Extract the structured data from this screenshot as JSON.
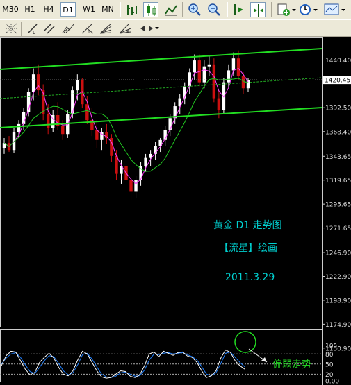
{
  "toolbar": {
    "timeframes": [
      "M30",
      "H1",
      "H4",
      "D1",
      "W1",
      "MN"
    ],
    "active_timeframe": "D1"
  },
  "annotations": {
    "line1": "黄金 D1 走势图",
    "line2": "【流星】绘画",
    "line3": "2011.3.29",
    "osc_note": "偏弱走势"
  },
  "chart_data": {
    "type": "candlestick",
    "symbol": "黄金",
    "timeframe": "D1",
    "price_axis": {
      "ticks": [
        "1440.40",
        "1392.50",
        "1368.40",
        "1343.65",
        "1319.65",
        "1295.65",
        "1271.65",
        "1246.90",
        "1222.90",
        "1198.90",
        "1174.90",
        "1150.90"
      ],
      "current_price": "1420.45",
      "ylim": [
        1150.9,
        1462
      ]
    },
    "oscillator": {
      "name": "Stochastic",
      "ticks": [
        "105",
        "80",
        "50",
        "20",
        "0.00"
      ],
      "levels": [
        80,
        50,
        20
      ],
      "k": [
        45,
        75,
        88,
        86,
        60,
        35,
        18,
        25,
        55,
        70,
        82,
        68,
        40,
        20,
        15,
        30,
        62,
        88,
        80,
        55,
        30,
        12,
        8,
        10,
        20,
        30,
        28,
        14,
        10,
        18,
        45,
        80,
        86,
        72,
        88,
        82,
        76,
        84,
        86,
        74,
        70,
        55,
        30,
        10,
        15,
        30,
        68,
        92,
        85,
        60,
        45,
        35
      ],
      "d": [
        50,
        68,
        80,
        84,
        70,
        48,
        28,
        22,
        40,
        60,
        75,
        72,
        52,
        30,
        18,
        24,
        48,
        78,
        82,
        65,
        42,
        20,
        12,
        10,
        14,
        24,
        26,
        20,
        14,
        15,
        32,
        62,
        80,
        78,
        82,
        84,
        80,
        82,
        84,
        78,
        72,
        62,
        42,
        20,
        16,
        24,
        52,
        82,
        86,
        70,
        55,
        42
      ]
    },
    "candles": [
      [
        1352,
        1362,
        1346,
        1357
      ],
      [
        1357,
        1364,
        1348,
        1350
      ],
      [
        1350,
        1372,
        1347,
        1368
      ],
      [
        1368,
        1380,
        1362,
        1376
      ],
      [
        1376,
        1392,
        1370,
        1388
      ],
      [
        1388,
        1412,
        1384,
        1408
      ],
      [
        1408,
        1432,
        1400,
        1426
      ],
      [
        1426,
        1436,
        1405,
        1410
      ],
      [
        1410,
        1416,
        1380,
        1386
      ],
      [
        1386,
        1396,
        1366,
        1372
      ],
      [
        1372,
        1390,
        1368,
        1385
      ],
      [
        1385,
        1398,
        1370,
        1374
      ],
      [
        1374,
        1380,
        1360,
        1366
      ],
      [
        1366,
        1390,
        1362,
        1386
      ],
      [
        1386,
        1414,
        1382,
        1410
      ],
      [
        1410,
        1426,
        1400,
        1420
      ],
      [
        1420,
        1422,
        1392,
        1396
      ],
      [
        1396,
        1404,
        1376,
        1380
      ],
      [
        1380,
        1392,
        1364,
        1370
      ],
      [
        1370,
        1380,
        1352,
        1360
      ],
      [
        1360,
        1372,
        1350,
        1368
      ],
      [
        1368,
        1376,
        1356,
        1362
      ],
      [
        1362,
        1366,
        1338,
        1344
      ],
      [
        1344,
        1350,
        1320,
        1326
      ],
      [
        1326,
        1340,
        1316,
        1334
      ],
      [
        1334,
        1340,
        1316,
        1320
      ],
      [
        1320,
        1326,
        1300,
        1308
      ],
      [
        1308,
        1324,
        1302,
        1320
      ],
      [
        1320,
        1338,
        1314,
        1334
      ],
      [
        1334,
        1346,
        1328,
        1342
      ],
      [
        1342,
        1350,
        1334,
        1346
      ],
      [
        1346,
        1358,
        1340,
        1354
      ],
      [
        1354,
        1362,
        1348,
        1360
      ],
      [
        1360,
        1374,
        1354,
        1370
      ],
      [
        1370,
        1386,
        1364,
        1382
      ],
      [
        1382,
        1398,
        1376,
        1394
      ],
      [
        1394,
        1406,
        1386,
        1402
      ],
      [
        1402,
        1418,
        1396,
        1414
      ],
      [
        1414,
        1432,
        1406,
        1428
      ],
      [
        1428,
        1446,
        1420,
        1440
      ],
      [
        1440,
        1446,
        1414,
        1418
      ],
      [
        1418,
        1440,
        1412,
        1434
      ],
      [
        1434,
        1444,
        1424,
        1436
      ],
      [
        1436,
        1442,
        1398,
        1402
      ],
      [
        1402,
        1410,
        1382,
        1390
      ],
      [
        1390,
        1422,
        1386,
        1418
      ],
      [
        1418,
        1436,
        1412,
        1430
      ],
      [
        1430,
        1448,
        1424,
        1442
      ],
      [
        1442,
        1450,
        1420,
        1424
      ],
      [
        1424,
        1428,
        1406,
        1412
      ],
      [
        1412,
        1422,
        1408,
        1420
      ]
    ]
  }
}
